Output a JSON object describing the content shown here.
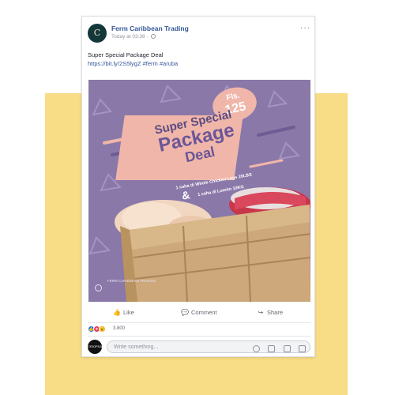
{
  "page": {
    "name": "Ferm Caribbean Trading",
    "time": "Today at 03:38 ·",
    "avatar_letter": "C",
    "more": "···"
  },
  "post": {
    "text": "Super Special Package Deal",
    "link": "https://bit.ly/2S5lygZ #ferm #aruba"
  },
  "ad": {
    "price_label": "Fls.",
    "price_value": "125",
    "title_line1": "Super Special",
    "title_line2": "Package",
    "title_line3": "Deal",
    "offer_line1": "1 caha di Whole Chicken Legs 20LBS",
    "ampersand": "&",
    "offer_line2": "1 caha di Lomito 10KG",
    "logo_text": "FERM CARIBBEAN TRADING"
  },
  "actions": {
    "like": "Like",
    "comment": "Comment",
    "share": "Share"
  },
  "reactions": {
    "count": "3.800"
  },
  "comment": {
    "placeholder": "Write something...",
    "avatar_text": "CRIOPSA"
  },
  "colors": {
    "yellow": "#f8dc86",
    "ad_purple": "#8a78a9",
    "ad_pink": "#f0b6a9",
    "fb_link": "#365899"
  }
}
